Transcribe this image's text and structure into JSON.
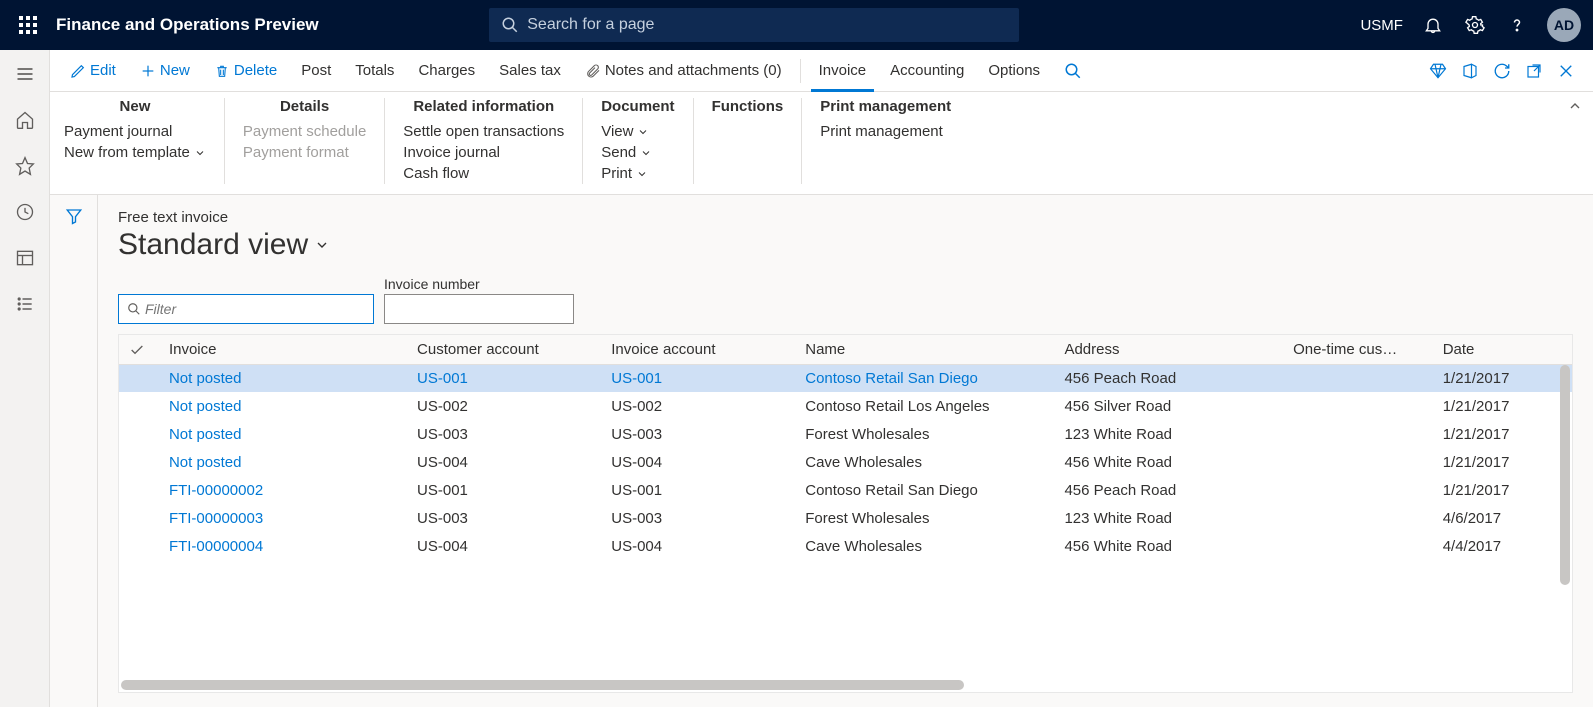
{
  "topbar": {
    "title": "Finance and Operations Preview",
    "search_placeholder": "Search for a page",
    "company": "USMF",
    "avatar": "AD"
  },
  "actionbar": {
    "edit": "Edit",
    "new": "New",
    "delete": "Delete",
    "post": "Post",
    "totals": "Totals",
    "charges": "Charges",
    "salestax": "Sales tax",
    "notes": "Notes and attachments (0)",
    "invoice": "Invoice",
    "accounting": "Accounting",
    "options": "Options"
  },
  "ribbon": {
    "groups": [
      {
        "title": "New",
        "items": [
          {
            "label": "Payment journal",
            "disabled": false,
            "chev": false
          },
          {
            "label": "New from template",
            "disabled": false,
            "chev": true
          }
        ]
      },
      {
        "title": "Details",
        "items": [
          {
            "label": "Payment schedule",
            "disabled": true,
            "chev": false
          },
          {
            "label": "Payment format",
            "disabled": true,
            "chev": false
          }
        ]
      },
      {
        "title": "Related information",
        "items": [
          {
            "label": "Settle open transactions",
            "disabled": false,
            "chev": false
          },
          {
            "label": "Invoice journal",
            "disabled": false,
            "chev": false
          },
          {
            "label": "Cash flow",
            "disabled": false,
            "chev": false
          }
        ]
      },
      {
        "title": "Document",
        "items": [
          {
            "label": "View",
            "disabled": false,
            "chev": true
          },
          {
            "label": "Send",
            "disabled": false,
            "chev": true
          },
          {
            "label": "Print",
            "disabled": false,
            "chev": true
          }
        ]
      },
      {
        "title": "Functions",
        "items": []
      },
      {
        "title": "Print management",
        "items": [
          {
            "label": "Print management",
            "disabled": false,
            "chev": false
          }
        ]
      }
    ]
  },
  "page": {
    "subtitle": "Free text invoice",
    "title": "Standard view",
    "filter_placeholder": "Filter",
    "invoice_number_label": "Invoice number"
  },
  "grid": {
    "columns": [
      "Invoice",
      "Customer account",
      "Invoice account",
      "Name",
      "Address",
      "One-time cus…",
      "Date"
    ],
    "rows": [
      {
        "selected": true,
        "invoice": "Not posted",
        "cust": "US-001",
        "invacc": "US-001",
        "name": "Contoso Retail San Diego",
        "addr": "456 Peach Road",
        "onetime": "",
        "date": "1/21/2017"
      },
      {
        "selected": false,
        "invoice": "Not posted",
        "cust": "US-002",
        "invacc": "US-002",
        "name": "Contoso Retail Los Angeles",
        "addr": "456 Silver Road",
        "onetime": "",
        "date": "1/21/2017"
      },
      {
        "selected": false,
        "invoice": "Not posted",
        "cust": "US-003",
        "invacc": "US-003",
        "name": "Forest Wholesales",
        "addr": "123 White Road",
        "onetime": "",
        "date": "1/21/2017"
      },
      {
        "selected": false,
        "invoice": "Not posted",
        "cust": "US-004",
        "invacc": "US-004",
        "name": "Cave Wholesales",
        "addr": "456 White Road",
        "onetime": "",
        "date": "1/21/2017"
      },
      {
        "selected": false,
        "invoice": "FTI-00000002",
        "cust": "US-001",
        "invacc": "US-001",
        "name": "Contoso Retail San Diego",
        "addr": "456 Peach Road",
        "onetime": "",
        "date": "1/21/2017"
      },
      {
        "selected": false,
        "invoice": "FTI-00000003",
        "cust": "US-003",
        "invacc": "US-003",
        "name": "Forest Wholesales",
        "addr": "123 White Road",
        "onetime": "",
        "date": "4/6/2017"
      },
      {
        "selected": false,
        "invoice": "FTI-00000004",
        "cust": "US-004",
        "invacc": "US-004",
        "name": "Cave Wholesales",
        "addr": "456 White Road",
        "onetime": "",
        "date": "4/4/2017"
      }
    ]
  }
}
